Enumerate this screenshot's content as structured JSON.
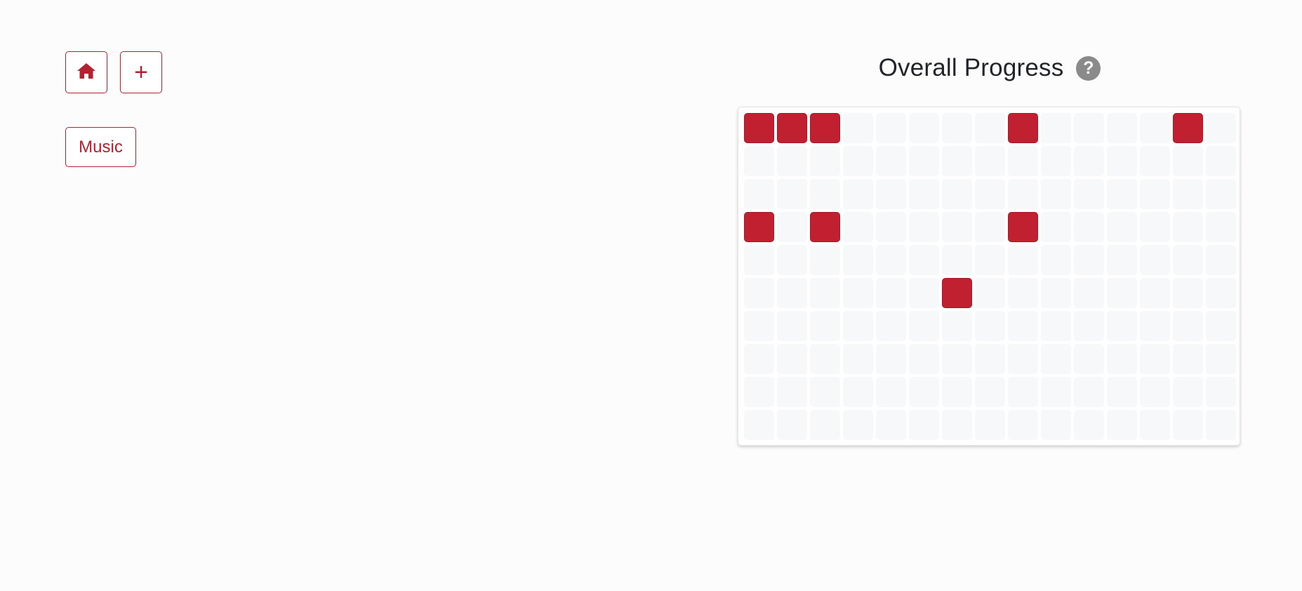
{
  "toolbar": {
    "home_icon": "home-icon",
    "add_label": "+"
  },
  "categories": [
    {
      "label": "Music"
    }
  ],
  "progress": {
    "title": "Overall Progress",
    "help_label": "?",
    "rows": 10,
    "columns": 15,
    "active_color": "#c02030",
    "inactive_color": "#f7f8fa",
    "filled_cells": [
      [
        0,
        0
      ],
      [
        0,
        1
      ],
      [
        0,
        2
      ],
      [
        0,
        8
      ],
      [
        0,
        13
      ],
      [
        3,
        0
      ],
      [
        3,
        2
      ],
      [
        3,
        8
      ],
      [
        5,
        6
      ]
    ]
  }
}
